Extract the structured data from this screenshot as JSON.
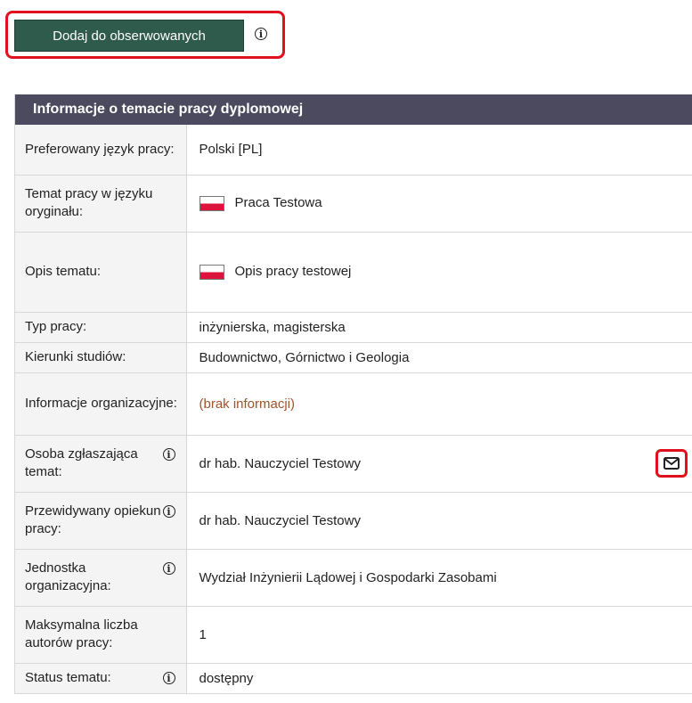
{
  "actions": {
    "follow_label": "Dodaj do obserwowanych"
  },
  "panel": {
    "title": "Informacje o temacie pracy dyplomowej",
    "rows": {
      "language": {
        "label": "Preferowany język pracy:",
        "value": "Polski [PL]"
      },
      "topic": {
        "label": "Temat pracy w języku oryginału:",
        "value": "Praca Testowa"
      },
      "description": {
        "label": "Opis tematu:",
        "value": "Opis pracy testowej"
      },
      "type": {
        "label": "Typ pracy:",
        "value": "inżynierska, magisterska"
      },
      "fields": {
        "label": "Kierunki studiów:",
        "value": "Budownictwo, Górnictwo i Geologia"
      },
      "org_info": {
        "label": "Informacje organizacyjne:",
        "value": "(brak informacji)"
      },
      "submitter": {
        "label": "Osoba zgłaszająca temat:",
        "value": "dr hab. Nauczyciel Testowy"
      },
      "supervisor": {
        "label": "Przewidywany opiekun pracy:",
        "value": "dr hab. Nauczyciel Testowy"
      },
      "unit": {
        "label": "Jednostka organizacyjna:",
        "value": "Wydział Inżynierii Lądowej i Gospodarki Zasobami"
      },
      "max_authors": {
        "label": "Maksymalna liczba autorów pracy:",
        "value": "1"
      },
      "status": {
        "label": "Status tematu:",
        "value": "dostępny"
      }
    }
  },
  "colors": {
    "button_bg": "#2e5b4c",
    "header_bg": "#4b4a5e",
    "highlight": "#e0111e",
    "muted_text": "#a0522d"
  },
  "icons": [
    "info-icon",
    "mail-icon",
    "flag-pl-icon"
  ]
}
